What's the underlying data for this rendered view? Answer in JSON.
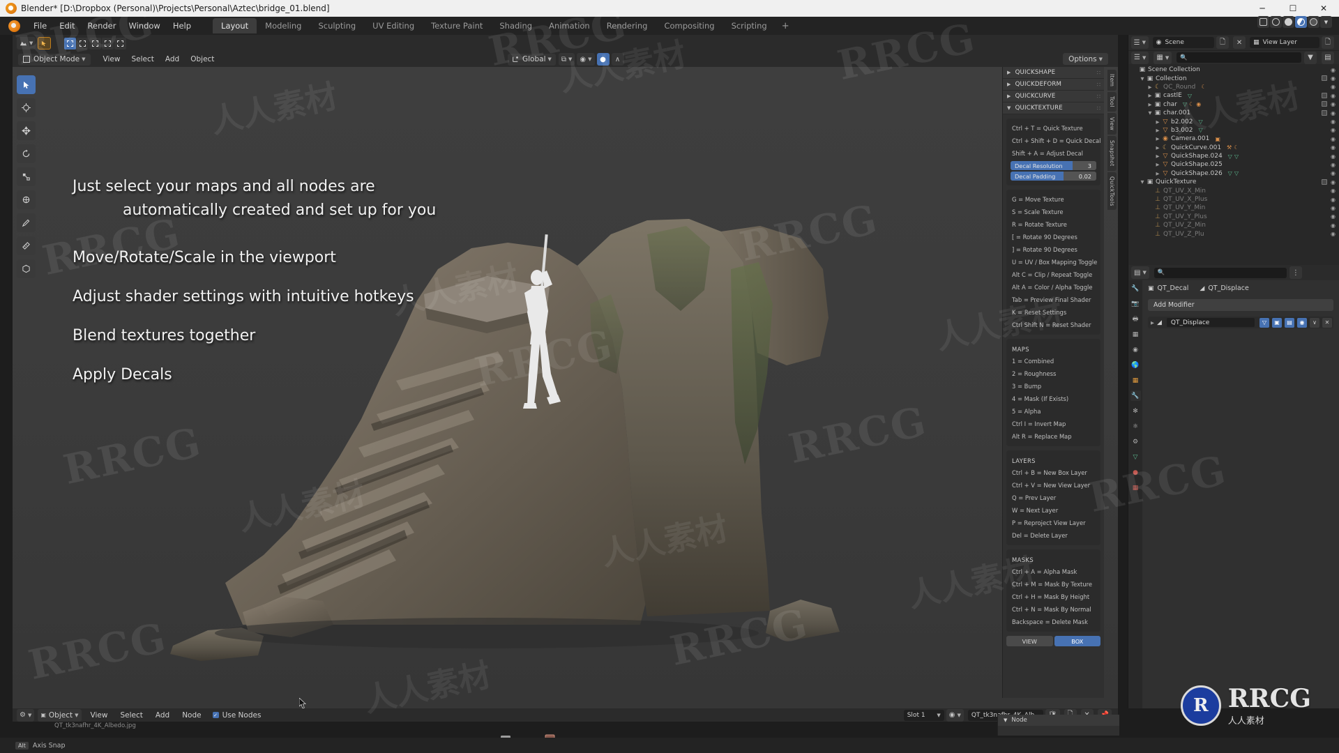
{
  "window": {
    "title": "Blender* [D:\\Dropbox (Personal)\\Projects\\Personal\\Aztec\\bridge_01.blend]",
    "minimize": "─",
    "maximize": "☐",
    "close": "✕"
  },
  "menubar": {
    "items": [
      "File",
      "Edit",
      "Render",
      "Window",
      "Help"
    ]
  },
  "workspace_tabs": {
    "items": [
      "Layout",
      "Modeling",
      "Sculpting",
      "UV Editing",
      "Texture Paint",
      "Shading",
      "Animation",
      "Rendering",
      "Compositing",
      "Scripting"
    ],
    "active": "Layout",
    "add_label": "+"
  },
  "viewport_header": {
    "mode": "Object Mode",
    "menus": [
      "View",
      "Select",
      "Add",
      "Object"
    ],
    "transform_orientation": "Global",
    "options_label": "Options"
  },
  "viewport_text": {
    "line1a": "Just select your maps and all nodes are",
    "line1b": "automatically created and set up for you",
    "line2": "Move/Rotate/Scale in the viewport",
    "line3": "Adjust shader settings with intuitive hotkeys",
    "line4": "Blend textures together",
    "line5": "Apply Decals"
  },
  "npanel": {
    "accordions": [
      {
        "label": "QUICKSHAPE",
        "open": false
      },
      {
        "label": "QUICKDEFORM",
        "open": false
      },
      {
        "label": "QUICKCURVE",
        "open": false
      },
      {
        "label": "QUICKTEXTURE",
        "open": true
      }
    ],
    "hotkeys_top": [
      "Ctrl + T = Quick Texture",
      "Ctrl + Shift + D = Quick Decal",
      "Shift + A = Adjust Decal"
    ],
    "sliders": [
      {
        "label": "Decal Resolution",
        "value": "3",
        "fill_pct": 72
      },
      {
        "label": "Decal Padding",
        "value": "0.02",
        "fill_pct": 62
      }
    ],
    "hotkeys_mid": [
      "G = Move Texture",
      "S = Scale Texture",
      "R = Rotate Texture",
      "[ = Rotate 90 Degrees",
      "] = Rotate 90 Degrees",
      "U = UV / Box Mapping Toggle",
      "Alt C = Clip / Repeat Toggle",
      "Alt A = Color / Alpha Toggle",
      "Tab = Preview Final Shader",
      "K = Reset Settings",
      "Ctrl Shift N = Reset Shader"
    ],
    "maps_title": "MAPS",
    "maps": [
      "1 = Combined",
      "2 = Roughness",
      "3 = Bump",
      "4 = Mask (If Exists)",
      "5 = Alpha",
      "Ctrl I = Invert Map",
      "Alt R = Replace Map"
    ],
    "layers_title": "LAYERS",
    "layers": [
      "Ctrl + B = New Box Layer",
      "Ctrl + V = New View Layer",
      "Q = Prev Layer",
      "W = Next Layer",
      "P = Reproject View Layer",
      "Del = Delete Layer"
    ],
    "masks_title": "MASKS",
    "masks": [
      "Ctrl + A = Alpha Mask",
      "Ctrl + M = Mask By Texture",
      "Ctrl + H = Mask By Height",
      "Ctrl + N = Mask By Normal",
      "Backspace = Delete Mask"
    ],
    "toggles": [
      {
        "label": "VIEW",
        "active": false
      },
      {
        "label": "BOX",
        "active": true
      }
    ]
  },
  "side_tabs": [
    "Item",
    "Tool",
    "View",
    "Snapshot",
    "QuickTools"
  ],
  "outliner": {
    "scene_name": "Scene",
    "view_layer_name": "View Layer",
    "search_placeholder": "",
    "rows": [
      {
        "indent": 0,
        "tri": "",
        "icon": "▣",
        "name": "Scene Collection",
        "dim": false,
        "check": false
      },
      {
        "indent": 1,
        "tri": "▼",
        "icon": "▣",
        "name": "Collection",
        "dim": false,
        "check": true
      },
      {
        "indent": 2,
        "tri": "▶",
        "icon": "☾",
        "name": "QC_Round",
        "dim": true,
        "check": false
      },
      {
        "indent": 2,
        "tri": "▶",
        "icon": "▣",
        "name": "castlE",
        "dim": false,
        "check": true
      },
      {
        "indent": 2,
        "tri": "▶",
        "icon": "▣",
        "name": "char",
        "dim": false,
        "check": true
      },
      {
        "indent": 2,
        "tri": "▼",
        "icon": "▣",
        "name": "char.001",
        "dim": false,
        "check": true
      },
      {
        "indent": 3,
        "tri": "▶",
        "icon": "▽",
        "name": "b2.002",
        "dim": false,
        "check": false
      },
      {
        "indent": 3,
        "tri": "▶",
        "icon": "▽",
        "name": "b3.002",
        "dim": false,
        "check": false
      },
      {
        "indent": 3,
        "tri": "▶",
        "icon": "◉",
        "name": "Camera.001",
        "dim": false,
        "check": false
      },
      {
        "indent": 3,
        "tri": "▶",
        "icon": "☾",
        "name": "QuickCurve.001",
        "dim": false,
        "check": false
      },
      {
        "indent": 3,
        "tri": "▶",
        "icon": "▽",
        "name": "QuickShape.024",
        "dim": false,
        "check": false
      },
      {
        "indent": 3,
        "tri": "▶",
        "icon": "▽",
        "name": "QuickShape.025",
        "dim": false,
        "check": false
      },
      {
        "indent": 3,
        "tri": "▶",
        "icon": "▽",
        "name": "QuickShape.026",
        "dim": false,
        "check": false
      },
      {
        "indent": 1,
        "tri": "▼",
        "icon": "▣",
        "name": "QuickTexture",
        "dim": false,
        "check": true
      },
      {
        "indent": 2,
        "tri": "",
        "icon": "⊥",
        "name": "QT_UV_X_Min",
        "dim": true,
        "check": false
      },
      {
        "indent": 2,
        "tri": "",
        "icon": "⊥",
        "name": "QT_UV_X_Plus",
        "dim": true,
        "check": false
      },
      {
        "indent": 2,
        "tri": "",
        "icon": "⊥",
        "name": "QT_UV_Y_Min",
        "dim": true,
        "check": false
      },
      {
        "indent": 2,
        "tri": "",
        "icon": "⊥",
        "name": "QT_UV_Y_Plus",
        "dim": true,
        "check": false
      },
      {
        "indent": 2,
        "tri": "",
        "icon": "⊥",
        "name": "QT_UV_Z_Min",
        "dim": true,
        "check": false
      },
      {
        "indent": 2,
        "tri": "",
        "icon": "⊥",
        "name": "QT_UV_Z_Plu",
        "dim": true,
        "check": false
      }
    ]
  },
  "properties": {
    "breadcrumb": [
      {
        "icon": "▣",
        "label": "QT_Decal"
      },
      {
        "icon": "◩",
        "label": "QT_Displace"
      }
    ],
    "add_modifier": "Add Modifier",
    "modifier": {
      "name": "QT_Displace",
      "buttons": [
        "▽",
        "⧉",
        "▣",
        "◉"
      ],
      "menu": "∨",
      "close": "✕"
    }
  },
  "node_editor": {
    "object_label": "Object",
    "menus": [
      "View",
      "Select",
      "Add",
      "Node"
    ],
    "use_nodes": "Use Nodes",
    "slot": "Slot 1",
    "material": "QT_tk3nafhr_4K_Alb..",
    "image_name": "QT_tk3nafhr_4K_Albedo.jpg",
    "panel_label": "Node"
  },
  "statusbar": {
    "key": "Alt",
    "text": "Axis Snap"
  },
  "watermark": {
    "brand": "RRCG",
    "cn": "人人素材",
    "logo_initials": "R",
    "logo_text": "RRCG",
    "logo_sub": "人人素材"
  },
  "colors": {
    "accent_blue": "#4772b3",
    "panel_bg": "#303030",
    "editor_bg": "#282828",
    "viewport_bg": "#3b3b3b",
    "header_bg": "#2b2b2b"
  }
}
